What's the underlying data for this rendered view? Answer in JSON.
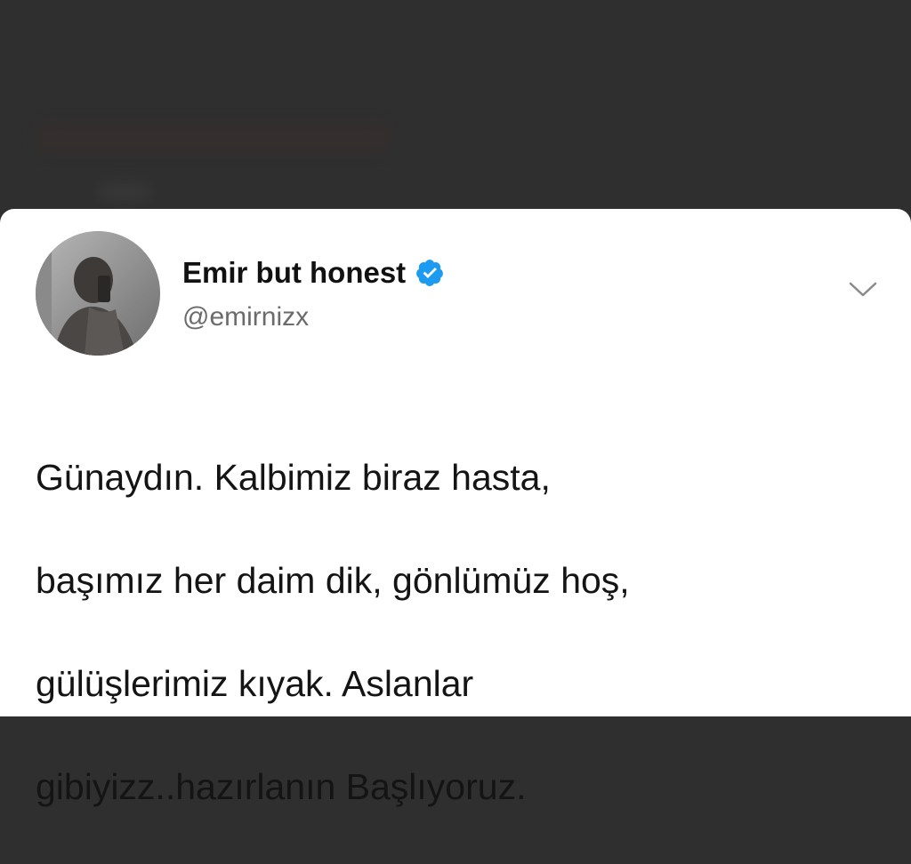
{
  "tweet": {
    "display_name": "Emir but honest",
    "handle": "@emirnizx",
    "verified": true,
    "text_lines": [
      "Günaydın. Kalbimiz biraz hasta,",
      "başımız her daim dik, gönlümüz hoş,",
      "gülüşlerimiz kıyak. Aslanlar",
      "gibiyizz..hazırlanın Başlıyoruz."
    ]
  },
  "icons": {
    "verified": "verified-badge-icon",
    "menu": "chevron-down-icon"
  },
  "colors": {
    "verified_blue": "#1d9bf0",
    "background_dark": "#2f2f2f",
    "card_background": "#ffffff"
  }
}
